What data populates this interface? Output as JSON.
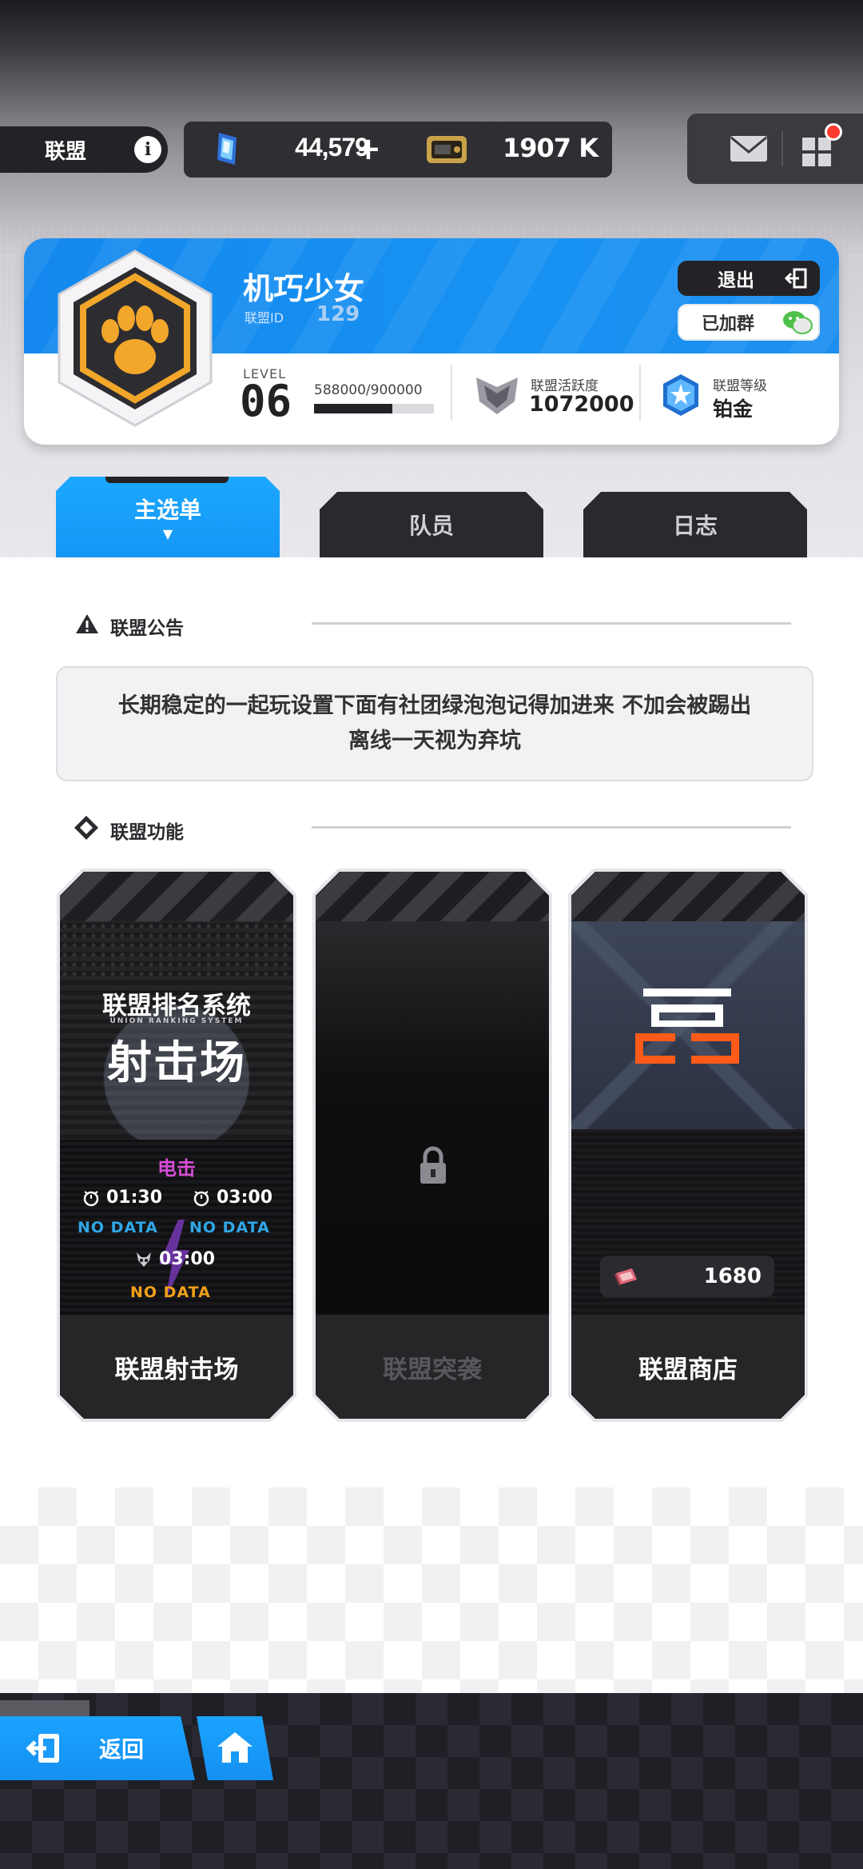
{
  "header": {
    "screen_label": "联盟",
    "crystal_amount": "44,579",
    "ticket_amount": "1907 K"
  },
  "guild": {
    "name": "机巧少女",
    "id_label": "联盟ID",
    "id_value": "129",
    "exit_label": "退出",
    "joined_label": "已加群",
    "level_label": "LEVEL",
    "level_value": "06",
    "exp_text": "588000/900000",
    "exp_progress": 0.653,
    "activity_label": "联盟活跃度",
    "activity_value": "1072000",
    "rank_label": "联盟等级",
    "rank_value": "铂金"
  },
  "tabs": [
    {
      "label": "主选单",
      "active": true
    },
    {
      "label": "队员",
      "active": false
    },
    {
      "label": "日志",
      "active": false
    }
  ],
  "announcement": {
    "title": "联盟公告",
    "line1": "长期稳定的一起玩设置下面有社团绿泡泡记得加进来 不加会被踢出",
    "line2": "离线一天视为弃坑"
  },
  "functions": {
    "title": "联盟功能",
    "shooting": {
      "art_title_top": "联盟排名系统",
      "art_subtitle": "UNION RANKING SYSTEM",
      "art_title_main": "射击场",
      "element": "电击",
      "timer1": "01:30",
      "timer2": "03:00",
      "timer3": "03:00",
      "nodata1": "NO DATA",
      "nodata2": "NO DATA",
      "nodata3": "NO DATA",
      "label": "联盟射击场"
    },
    "raid": {
      "label": "联盟突袭",
      "locked": true
    },
    "shop": {
      "price": "1680",
      "label": "联盟商店"
    }
  },
  "bottom_nav": {
    "back_label": "返回"
  },
  "colors": {
    "accent_blue": "#1792f2",
    "element_purple": "#d64dd6",
    "nodata_blue": "#2fa8e8",
    "nodata_orange": "#f0a01a",
    "shop_orange": "#ff5a1a",
    "notify_red": "#ff3b30"
  }
}
